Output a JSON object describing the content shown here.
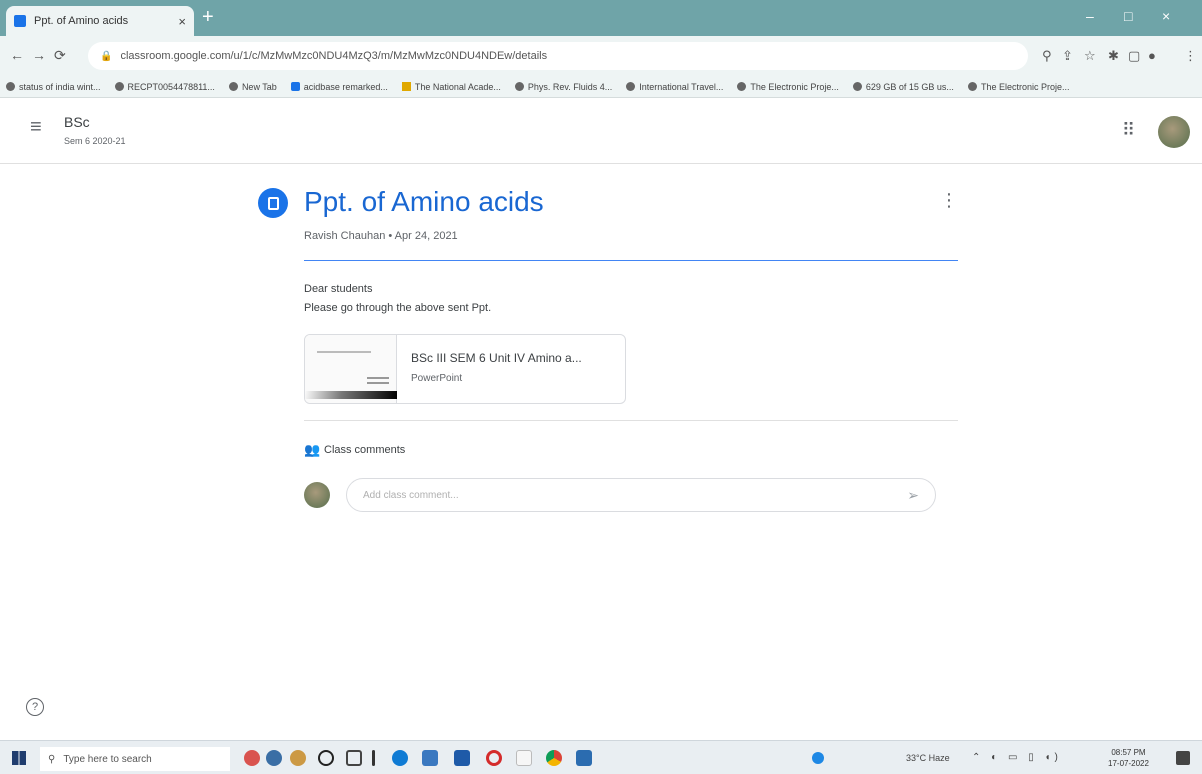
{
  "browser": {
    "tab_title": "Ppt. of Amino acids",
    "tab_close": "×",
    "new_tab": "+",
    "window_controls": {
      "minimize": "–",
      "restore": "□",
      "close": "×"
    },
    "url": "classroom.google.com/u/1/c/MzMwMzc0NDU4MzQ3/m/MzMwMzc0NDU4NDEw/details",
    "bookmarks": [
      "status of india wint...",
      "RECPT0054478811...",
      "New Tab",
      "acidbase remarked...",
      "The National Acade...",
      "Phys. Rev. Fluids 4...",
      "International Travel...",
      "The Electronic Proje...",
      "629 GB of 15 GB us...",
      "The Electronic Proje..."
    ]
  },
  "header": {
    "course_name": "BSc",
    "course_section": "Sem 6 2020-21"
  },
  "post": {
    "title": "Ppt. of Amino acids",
    "meta": "Ravish Chauhan • Apr 24, 2021",
    "body_line1": "Dear students",
    "body_line2": "Please go through the above sent Ppt.",
    "attachment": {
      "title": "BSc III SEM 6 Unit IV Amino a...",
      "type": "PowerPoint"
    }
  },
  "comments": {
    "label": "Class comments",
    "placeholder": "Add class comment..."
  },
  "taskbar": {
    "search_placeholder": "Type here to search",
    "weather": "33°C Haze",
    "time": "08:57 PM",
    "date": "17-07-2022"
  },
  "colors": {
    "accent": "#1967d2",
    "icon_blue": "#1a73e8",
    "titlebar": "#6fa4a8"
  }
}
